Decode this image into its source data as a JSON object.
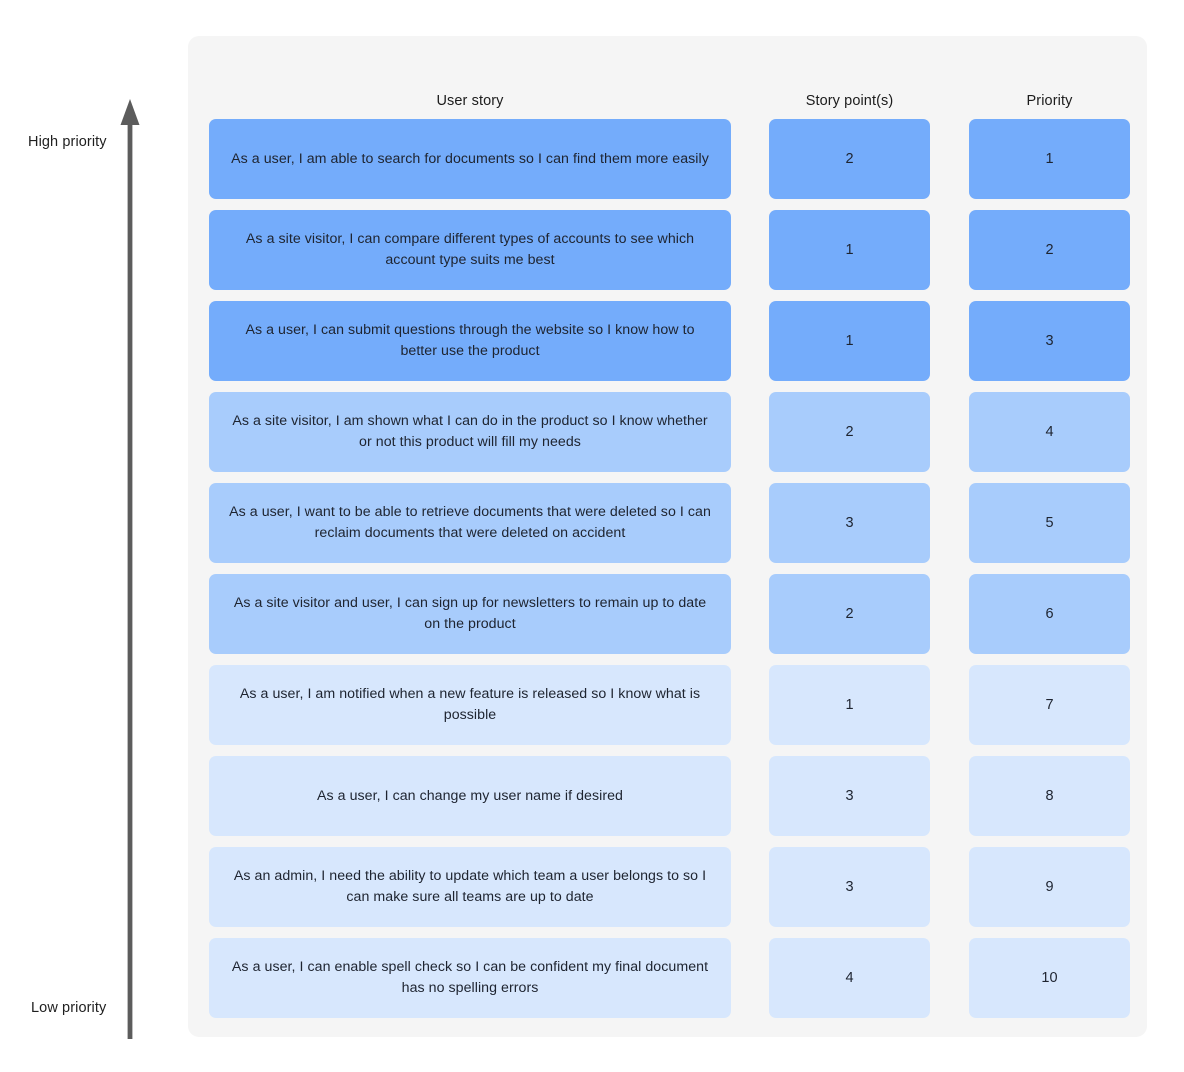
{
  "axis": {
    "high_label": "High priority",
    "low_label": "Low priority",
    "arrow_icon": "up-arrow-icon",
    "arrow_color": "#5c5c5c"
  },
  "board": {
    "background": "#f5f5f5",
    "columns": [
      {
        "key": "user_story",
        "label": "User story"
      },
      {
        "key": "story_points",
        "label": "Story point(s)"
      },
      {
        "key": "priority",
        "label": "Priority"
      }
    ],
    "tier_colors": {
      "high": "#74acfb",
      "medium": "#a8ccfc",
      "low": "#d7e7fd"
    },
    "rows": [
      {
        "user_story": "As a user, I am able to search for documents so I can find them more easily",
        "story_points": "2",
        "priority": "1",
        "tier": "high"
      },
      {
        "user_story": "As a site visitor, I can compare different types of accounts to see which account type suits me best",
        "story_points": "1",
        "priority": "2",
        "tier": "high"
      },
      {
        "user_story": "As a user, I can submit questions through the website so I know how to better use the product",
        "story_points": "1",
        "priority": "3",
        "tier": "high"
      },
      {
        "user_story": "As a site visitor, I am shown what I can do in the product so I know whether or not this product will fill my needs",
        "story_points": "2",
        "priority": "4",
        "tier": "medium"
      },
      {
        "user_story": "As a user, I want to be able to retrieve documents that were deleted so I can reclaim documents that were deleted on accident",
        "story_points": "3",
        "priority": "5",
        "tier": "medium"
      },
      {
        "user_story": "As a site visitor and user, I can sign up for newsletters to remain up to date on the product",
        "story_points": "2",
        "priority": "6",
        "tier": "medium"
      },
      {
        "user_story": "As a user, I am notified when a new feature is released so I know what is possible",
        "story_points": "1",
        "priority": "7",
        "tier": "low"
      },
      {
        "user_story": "As a user, I can change my user name if desired",
        "story_points": "3",
        "priority": "8",
        "tier": "low"
      },
      {
        "user_story": "As an admin, I need the ability to update which team a user belongs to so I can make sure all teams are up to date",
        "story_points": "3",
        "priority": "9",
        "tier": "low"
      },
      {
        "user_story": "As a user, I can enable spell check so I can be confident my final document has no spelling errors",
        "story_points": "4",
        "priority": "10",
        "tier": "low"
      }
    ]
  }
}
